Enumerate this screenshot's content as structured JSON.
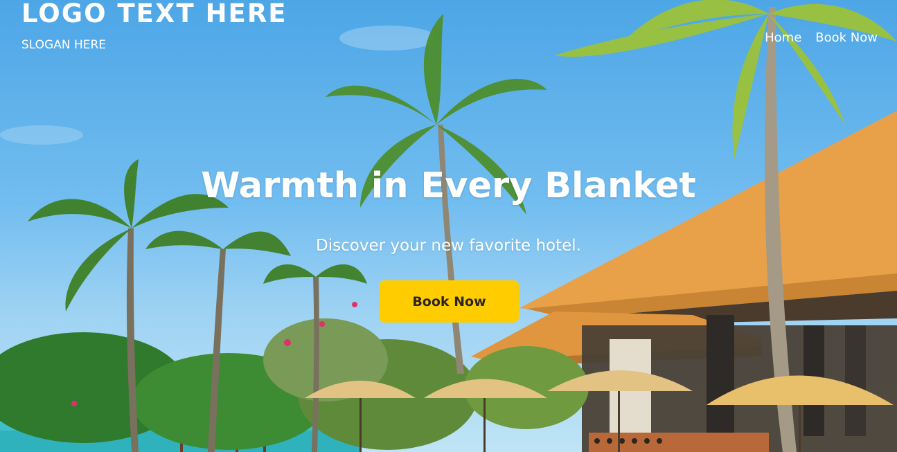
{
  "header": {
    "logo_text": "LOGO TEXT HERE",
    "slogan": "SLOGAN HERE",
    "nav": [
      {
        "label": "Home"
      },
      {
        "label": "Book Now"
      }
    ]
  },
  "hero": {
    "headline": "Warmth in Every Blanket",
    "subheadline": "Discover your new favorite hotel.",
    "cta_label": "Book Now",
    "background_image": "tropical-resort-palms-umbrellas"
  },
  "colors": {
    "accent": "#ffcc00",
    "cta_text": "#2a2520",
    "text_on_image": "#ffffff",
    "sky": "#5aaee8",
    "roof": "#e59a3d"
  }
}
